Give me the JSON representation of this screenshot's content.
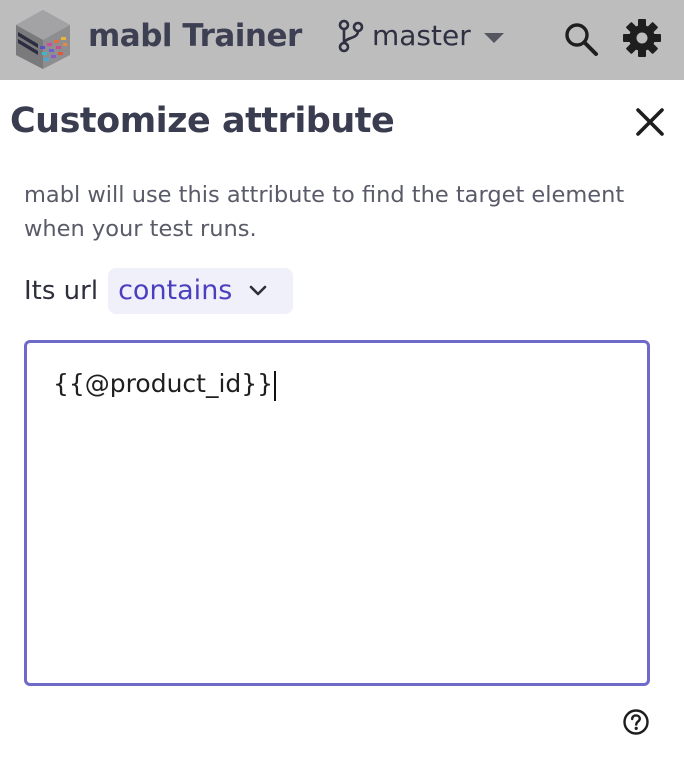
{
  "header": {
    "app_title": "mabl Trainer",
    "branch": "master",
    "icons": [
      "mabl-logo",
      "branch-icon",
      "chevron-down-icon",
      "search-icon",
      "gear-icon"
    ]
  },
  "panel": {
    "title": "Customize attribute",
    "description": "mabl will use this attribute to find the target element when your test runs.",
    "url_label": "Its url",
    "match_mode": "contains",
    "value": "{{@product_id}}"
  },
  "colors": {
    "header_bg": "#bdbdbd",
    "accent": "#4b3fbf",
    "input_border": "#6f6ac7",
    "select_bg": "#f0f0fb"
  }
}
